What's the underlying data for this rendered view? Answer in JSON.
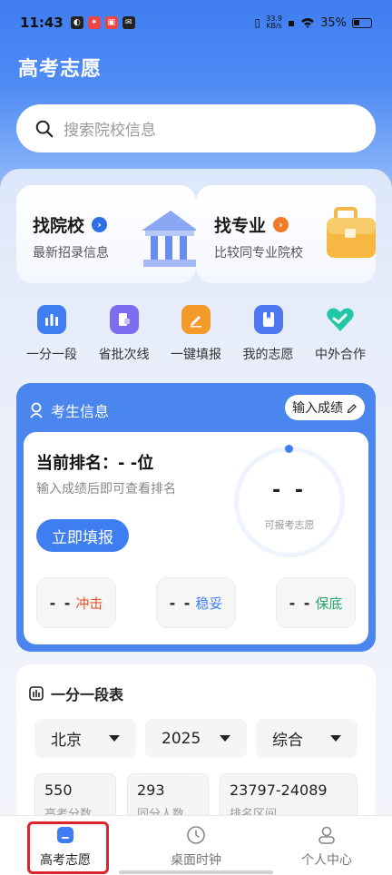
{
  "status_bar": {
    "time": "11:43",
    "net_speed": "33.9\nKB/s",
    "battery": "35%"
  },
  "header": {
    "title": "高考志愿"
  },
  "search": {
    "placeholder": "搜索院校信息"
  },
  "find_cards": [
    {
      "title": "找院校",
      "subtitle": "最新招录信息",
      "accent": "#2f6fe8"
    },
    {
      "title": "找专业",
      "subtitle": "比较同专业院校",
      "accent": "#f07b26"
    }
  ],
  "quick_entries": [
    {
      "label": "一分一段",
      "icon": "bar-chart-icon",
      "color": "#3f7ef2"
    },
    {
      "label": "省批次线",
      "icon": "document-icon",
      "color": "#7b6cf0"
    },
    {
      "label": "一键填报",
      "icon": "pencil-icon",
      "color": "#f39a2a"
    },
    {
      "label": "我的志愿",
      "icon": "bookmark-icon",
      "color": "#4e78ef"
    },
    {
      "label": "中外合作",
      "icon": "heart-icon",
      "color": "#22c7a8"
    }
  ],
  "exam": {
    "header": "考生信息",
    "input_score": "输入成绩",
    "rank": "当前排名：- -位",
    "rank_tip": "输入成绩后即可查看排名",
    "fill_button": "立即填报",
    "ring_value": "- -",
    "ring_label": "可报考志愿",
    "chips": [
      {
        "value": "- -",
        "label": "冲击",
        "color": "#e5562a"
      },
      {
        "value": "- -",
        "label": "稳妥",
        "color": "#3f7ef2"
      },
      {
        "value": "- -",
        "label": "保底",
        "color": "#27a86b"
      }
    ]
  },
  "segment": {
    "title": "一分一段表",
    "selects": [
      "北京",
      "2025",
      "综合"
    ],
    "stats": [
      {
        "value": "550",
        "label": "高考分数"
      },
      {
        "value": "293",
        "label": "同分人数"
      },
      {
        "value": "23797-24089",
        "label": "排名区间"
      }
    ]
  },
  "tabbar": {
    "tabs": [
      {
        "label": "高考志愿",
        "icon": "graduation-icon"
      },
      {
        "label": "桌面时钟",
        "icon": "clock-icon"
      },
      {
        "label": "个人中心",
        "icon": "person-icon"
      }
    ]
  }
}
